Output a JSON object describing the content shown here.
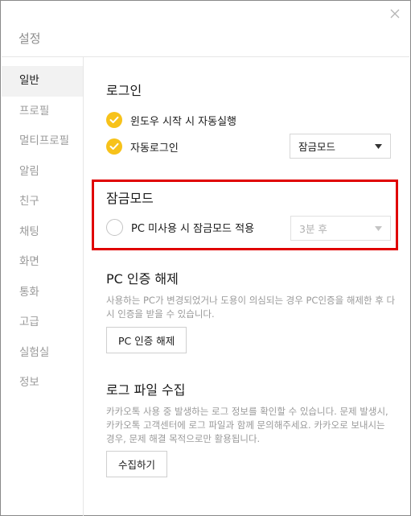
{
  "window": {
    "title": "설정",
    "close_icon": "close-icon"
  },
  "sidebar": {
    "items": [
      {
        "label": "일반",
        "active": true
      },
      {
        "label": "프로필",
        "active": false
      },
      {
        "label": "멀티프로필",
        "active": false
      },
      {
        "label": "알림",
        "active": false
      },
      {
        "label": "친구",
        "active": false
      },
      {
        "label": "채팅",
        "active": false
      },
      {
        "label": "화면",
        "active": false
      },
      {
        "label": "통화",
        "active": false
      },
      {
        "label": "고급",
        "active": false
      },
      {
        "label": "실험실",
        "active": false
      },
      {
        "label": "정보",
        "active": false
      }
    ]
  },
  "login": {
    "title": "로그인",
    "auto_start_label": "윈도우 시작 시 자동실행",
    "auto_start_checked": true,
    "auto_login_label": "자동로그인",
    "auto_login_checked": true,
    "auto_login_select": "잠금모드"
  },
  "lock_mode": {
    "title": "잠금모드",
    "idle_label": "PC 미사용 시 잠금모드 적용",
    "idle_checked": false,
    "idle_select": "3분 후",
    "highlight_color": "#e00000"
  },
  "pc_auth": {
    "title": "PC 인증 해제",
    "description": "사용하는 PC가 변경되었거나 도용이 의심되는 경우 PC인증을 해제한 후 다시 인증을 받을 수 있습니다.",
    "button_label": "PC 인증 해제"
  },
  "log": {
    "title": "로그 파일 수집",
    "description": "카카오톡 사용 중 발생하는 로그 정보를 확인할 수 있습니다. 문제 발생시, 카카오톡 고객센터에 로그 파일과 함께 문의해주세요. 카카오로 보내시는 경우, 문제 해결 목적으로만 활용됩니다.",
    "button_label": "수집하기"
  },
  "colors": {
    "accent_yellow": "#f7c21a",
    "highlight_red": "#e00000"
  }
}
